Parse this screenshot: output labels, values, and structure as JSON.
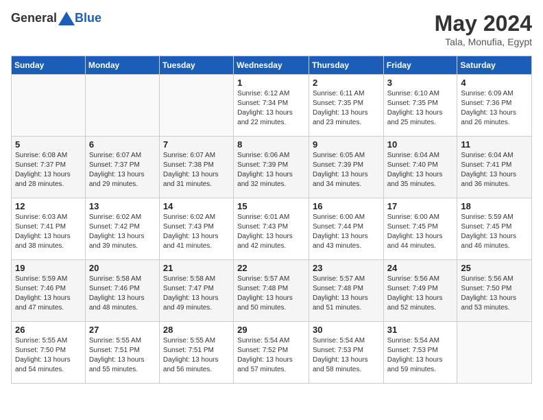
{
  "header": {
    "logo_general": "General",
    "logo_blue": "Blue",
    "month_year": "May 2024",
    "location": "Tala, Monufia, Egypt"
  },
  "weekdays": [
    "Sunday",
    "Monday",
    "Tuesday",
    "Wednesday",
    "Thursday",
    "Friday",
    "Saturday"
  ],
  "weeks": [
    [
      {
        "day": "",
        "info": ""
      },
      {
        "day": "",
        "info": ""
      },
      {
        "day": "",
        "info": ""
      },
      {
        "day": "1",
        "info": "Sunrise: 6:12 AM\nSunset: 7:34 PM\nDaylight: 13 hours and 22 minutes."
      },
      {
        "day": "2",
        "info": "Sunrise: 6:11 AM\nSunset: 7:35 PM\nDaylight: 13 hours and 23 minutes."
      },
      {
        "day": "3",
        "info": "Sunrise: 6:10 AM\nSunset: 7:35 PM\nDaylight: 13 hours and 25 minutes."
      },
      {
        "day": "4",
        "info": "Sunrise: 6:09 AM\nSunset: 7:36 PM\nDaylight: 13 hours and 26 minutes."
      }
    ],
    [
      {
        "day": "5",
        "info": "Sunrise: 6:08 AM\nSunset: 7:37 PM\nDaylight: 13 hours and 28 minutes."
      },
      {
        "day": "6",
        "info": "Sunrise: 6:07 AM\nSunset: 7:37 PM\nDaylight: 13 hours and 29 minutes."
      },
      {
        "day": "7",
        "info": "Sunrise: 6:07 AM\nSunset: 7:38 PM\nDaylight: 13 hours and 31 minutes."
      },
      {
        "day": "8",
        "info": "Sunrise: 6:06 AM\nSunset: 7:39 PM\nDaylight: 13 hours and 32 minutes."
      },
      {
        "day": "9",
        "info": "Sunrise: 6:05 AM\nSunset: 7:39 PM\nDaylight: 13 hours and 34 minutes."
      },
      {
        "day": "10",
        "info": "Sunrise: 6:04 AM\nSunset: 7:40 PM\nDaylight: 13 hours and 35 minutes."
      },
      {
        "day": "11",
        "info": "Sunrise: 6:04 AM\nSunset: 7:41 PM\nDaylight: 13 hours and 36 minutes."
      }
    ],
    [
      {
        "day": "12",
        "info": "Sunrise: 6:03 AM\nSunset: 7:41 PM\nDaylight: 13 hours and 38 minutes."
      },
      {
        "day": "13",
        "info": "Sunrise: 6:02 AM\nSunset: 7:42 PM\nDaylight: 13 hours and 39 minutes."
      },
      {
        "day": "14",
        "info": "Sunrise: 6:02 AM\nSunset: 7:43 PM\nDaylight: 13 hours and 41 minutes."
      },
      {
        "day": "15",
        "info": "Sunrise: 6:01 AM\nSunset: 7:43 PM\nDaylight: 13 hours and 42 minutes."
      },
      {
        "day": "16",
        "info": "Sunrise: 6:00 AM\nSunset: 7:44 PM\nDaylight: 13 hours and 43 minutes."
      },
      {
        "day": "17",
        "info": "Sunrise: 6:00 AM\nSunset: 7:45 PM\nDaylight: 13 hours and 44 minutes."
      },
      {
        "day": "18",
        "info": "Sunrise: 5:59 AM\nSunset: 7:45 PM\nDaylight: 13 hours and 46 minutes."
      }
    ],
    [
      {
        "day": "19",
        "info": "Sunrise: 5:59 AM\nSunset: 7:46 PM\nDaylight: 13 hours and 47 minutes."
      },
      {
        "day": "20",
        "info": "Sunrise: 5:58 AM\nSunset: 7:46 PM\nDaylight: 13 hours and 48 minutes."
      },
      {
        "day": "21",
        "info": "Sunrise: 5:58 AM\nSunset: 7:47 PM\nDaylight: 13 hours and 49 minutes."
      },
      {
        "day": "22",
        "info": "Sunrise: 5:57 AM\nSunset: 7:48 PM\nDaylight: 13 hours and 50 minutes."
      },
      {
        "day": "23",
        "info": "Sunrise: 5:57 AM\nSunset: 7:48 PM\nDaylight: 13 hours and 51 minutes."
      },
      {
        "day": "24",
        "info": "Sunrise: 5:56 AM\nSunset: 7:49 PM\nDaylight: 13 hours and 52 minutes."
      },
      {
        "day": "25",
        "info": "Sunrise: 5:56 AM\nSunset: 7:50 PM\nDaylight: 13 hours and 53 minutes."
      }
    ],
    [
      {
        "day": "26",
        "info": "Sunrise: 5:55 AM\nSunset: 7:50 PM\nDaylight: 13 hours and 54 minutes."
      },
      {
        "day": "27",
        "info": "Sunrise: 5:55 AM\nSunset: 7:51 PM\nDaylight: 13 hours and 55 minutes."
      },
      {
        "day": "28",
        "info": "Sunrise: 5:55 AM\nSunset: 7:51 PM\nDaylight: 13 hours and 56 minutes."
      },
      {
        "day": "29",
        "info": "Sunrise: 5:54 AM\nSunset: 7:52 PM\nDaylight: 13 hours and 57 minutes."
      },
      {
        "day": "30",
        "info": "Sunrise: 5:54 AM\nSunset: 7:53 PM\nDaylight: 13 hours and 58 minutes."
      },
      {
        "day": "31",
        "info": "Sunrise: 5:54 AM\nSunset: 7:53 PM\nDaylight: 13 hours and 59 minutes."
      },
      {
        "day": "",
        "info": ""
      }
    ]
  ]
}
